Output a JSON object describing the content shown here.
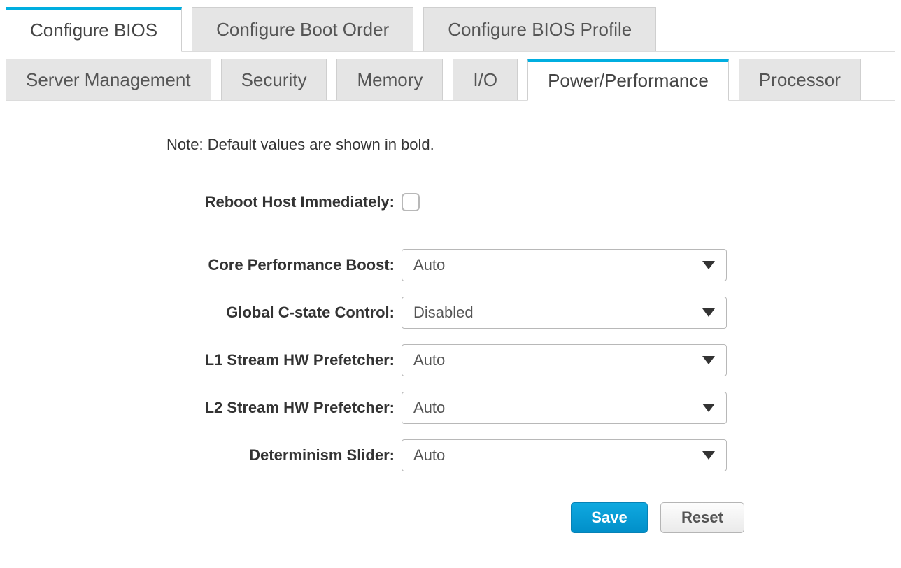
{
  "primary_tabs": {
    "items": [
      {
        "label": "Configure BIOS",
        "active": true
      },
      {
        "label": "Configure Boot Order",
        "active": false
      },
      {
        "label": "Configure BIOS Profile",
        "active": false
      }
    ]
  },
  "secondary_tabs": {
    "items": [
      {
        "label": "Server Management",
        "active": false
      },
      {
        "label": "Security",
        "active": false
      },
      {
        "label": "Memory",
        "active": false
      },
      {
        "label": "I/O",
        "active": false
      },
      {
        "label": "Power/Performance",
        "active": true
      },
      {
        "label": "Processor",
        "active": false
      }
    ]
  },
  "note": "Note: Default values are shown in bold.",
  "fields": {
    "reboot": {
      "label": "Reboot Host Immediately:",
      "checked": false
    },
    "core_boost": {
      "label": "Core Performance Boost:",
      "value": "Auto"
    },
    "cstate": {
      "label": "Global C-state Control:",
      "value": "Disabled"
    },
    "l1_prefetch": {
      "label": "L1 Stream HW Prefetcher:",
      "value": "Auto"
    },
    "l2_prefetch": {
      "label": "L2 Stream HW Prefetcher:",
      "value": "Auto"
    },
    "determinism": {
      "label": "Determinism Slider:",
      "value": "Auto"
    }
  },
  "buttons": {
    "save": "Save",
    "reset": "Reset"
  },
  "colors": {
    "accent": "#00aee0",
    "tab_bg": "#e5e5e5",
    "text": "#555"
  }
}
